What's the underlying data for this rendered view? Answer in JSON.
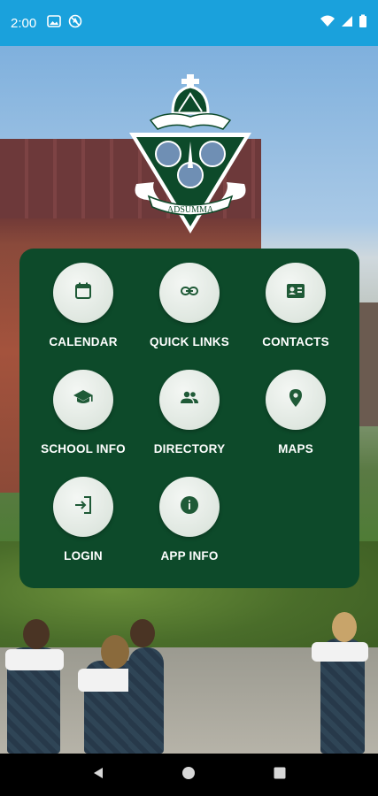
{
  "status_bar": {
    "time": "2:00",
    "left_icons": [
      "image-icon",
      "no-data-icon"
    ],
    "right_icons": [
      "wifi-icon",
      "signal-icon",
      "battery-icon"
    ]
  },
  "crest": {
    "motto": "ADSUMMA"
  },
  "menu": {
    "background_color": "#0d4a2a",
    "items": [
      {
        "label": "CALENDAR",
        "icon": "calendar-icon"
      },
      {
        "label": "QUICK LINKS",
        "icon": "link-icon"
      },
      {
        "label": "CONTACTS",
        "icon": "contact-card-icon"
      },
      {
        "label": "SCHOOL INFO",
        "icon": "graduation-cap-icon"
      },
      {
        "label": "DIRECTORY",
        "icon": "people-icon"
      },
      {
        "label": "MAPS",
        "icon": "map-pin-icon"
      },
      {
        "label": "LOGIN",
        "icon": "login-icon"
      },
      {
        "label": "APP INFO",
        "icon": "info-icon"
      }
    ]
  },
  "nav_bar": {
    "buttons": [
      "back-icon",
      "home-icon",
      "recents-icon"
    ]
  },
  "colors": {
    "status_bar": "#1aa1dc",
    "icon_green": "#1f5a37"
  }
}
